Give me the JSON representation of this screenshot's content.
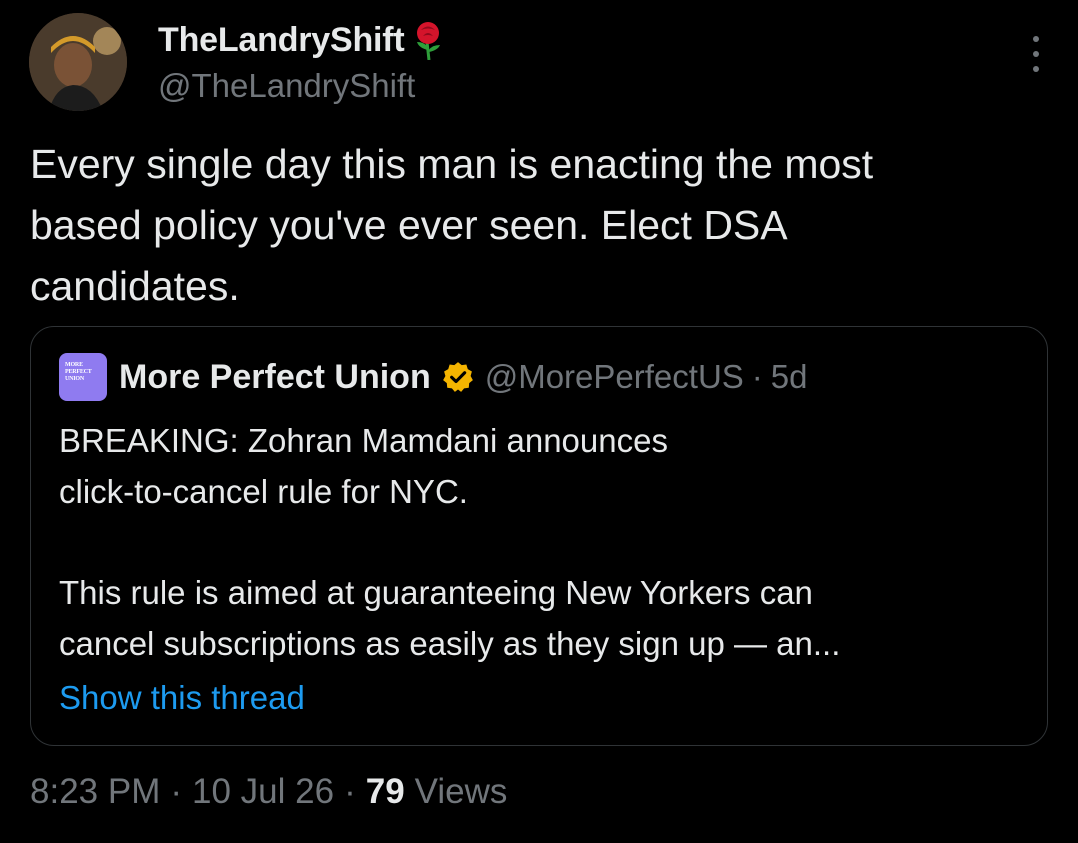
{
  "author": {
    "display_name": "TheLandryShift",
    "handle": "@TheLandryShift",
    "name_emoji_icon": "rose-icon"
  },
  "tweet": {
    "text": "Every single day this man is enacting the most\nbased policy you've ever seen. Elect DSA\ncandidates."
  },
  "quoted_tweet": {
    "avatar_text": "MORE PERFECT UNION",
    "display_name": "More Perfect Union",
    "verified_icon": "verified-badge-icon",
    "verified_color": "#f4b400",
    "handle": "@MorePerfectUS",
    "separator": "·",
    "time": "5d",
    "paragraph_1": "BREAKING: Zohran Mamdani announces\nclick-to-cancel rule for NYC.",
    "paragraph_2": "This rule is aimed at guaranteeing New Yorkers can\ncancel subscriptions as easily as they sign up — an...",
    "show_thread": "Show this thread"
  },
  "meta": {
    "time": "8:23 PM",
    "separator": "·",
    "date": "10 Jul 26",
    "views_count": "79",
    "views_label": "Views"
  },
  "colors": {
    "background": "#000000",
    "primary_text": "#e7e9ea",
    "secondary_text": "#71767b",
    "link": "#1d9bf0",
    "border": "#2f3336",
    "quote_avatar_bg": "#8f7bf0"
  }
}
